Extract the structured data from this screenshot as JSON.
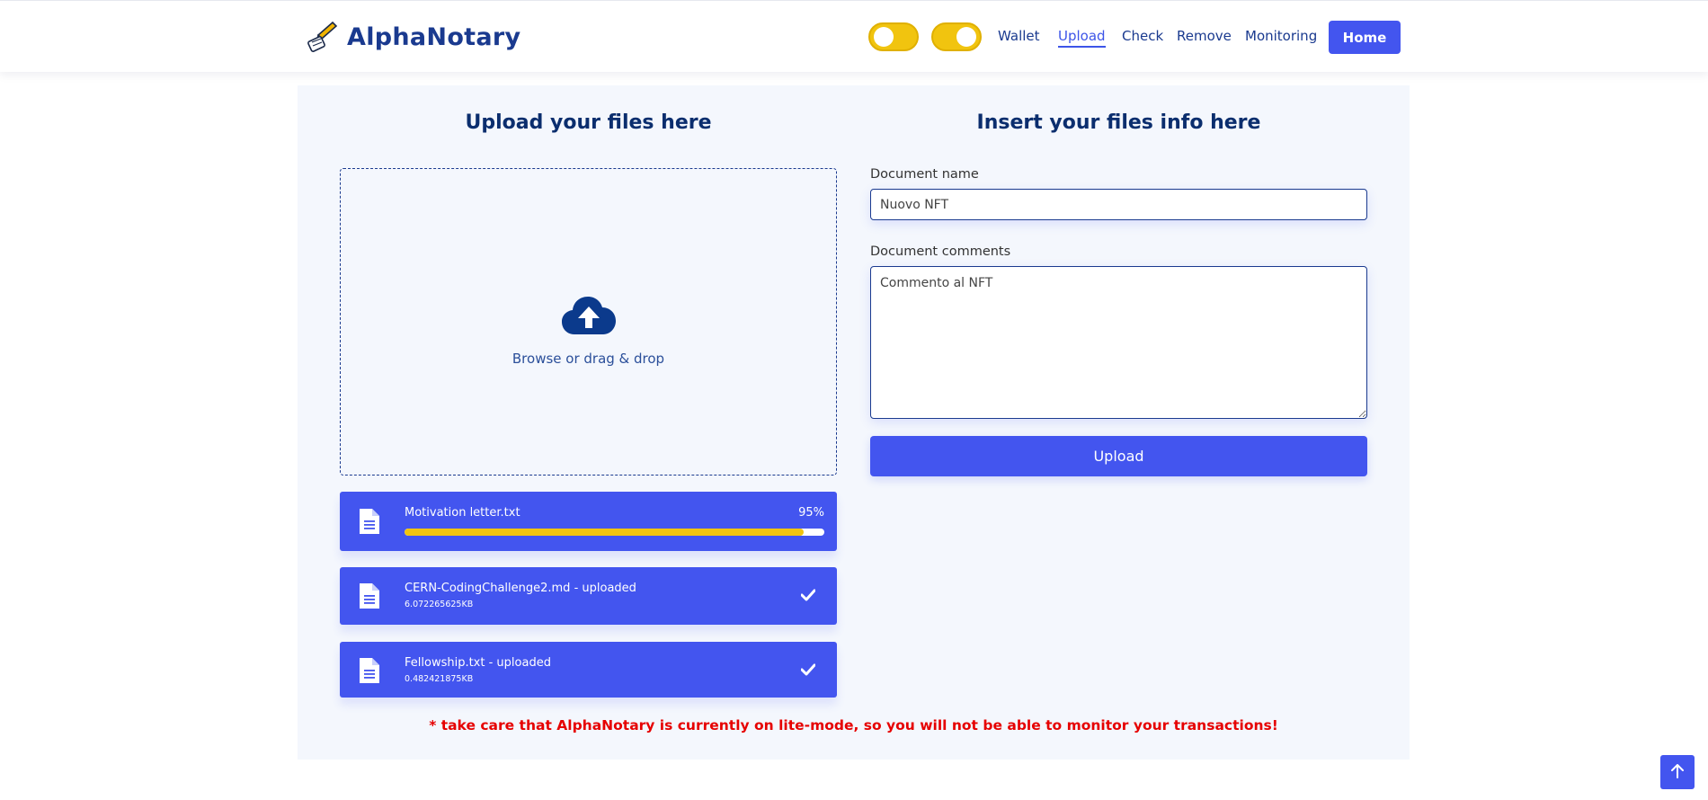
{
  "app": {
    "brand_name": "AlphaNotary",
    "accent_color": "#4355ef",
    "toggle_color": "#f1c40f",
    "warning_color": "#e60000"
  },
  "nav": {
    "toggles": [
      {
        "name": "toggle-1",
        "state": "off"
      },
      {
        "name": "toggle-2",
        "state": "on"
      }
    ],
    "links": {
      "wallet": "Wallet",
      "upload": "Upload",
      "check": "Check",
      "remove": "Remove",
      "monitoring": "Monitoring"
    },
    "active": "Upload",
    "home_button": "Home"
  },
  "upload_section": {
    "title": "Upload your files here",
    "dropzone_icon": "cloud-upload-icon",
    "dropzone_text": "Browse or drag & drop",
    "files": [
      {
        "name": "Motivation letter.txt",
        "progress_text": "95%",
        "progress": 0.95,
        "status": "uploading",
        "icon": "file-icon"
      },
      {
        "name": "CERN-CodingChallenge2.md - uploaded",
        "size": "6.072265625KB",
        "status": "uploaded",
        "icon": "file-icon",
        "status_icon": "check-icon"
      },
      {
        "name": "Fellowship.txt - uploaded",
        "size": "0.482421875KB",
        "status": "uploaded",
        "icon": "file-icon",
        "status_icon": "check-icon"
      }
    ]
  },
  "info_section": {
    "title": "Insert your files info here",
    "document_name_label": "Document name",
    "document_name_value": "Nuovo NFT",
    "document_comments_label": "Document comments",
    "document_comments_value": "Commento al NFT",
    "upload_button": "Upload"
  },
  "warning": "* take care that AlphaNotary is currently on lite-mode, so you will not be able to monitor your transactions!",
  "scroll_top_icon": "arrow-up-icon"
}
